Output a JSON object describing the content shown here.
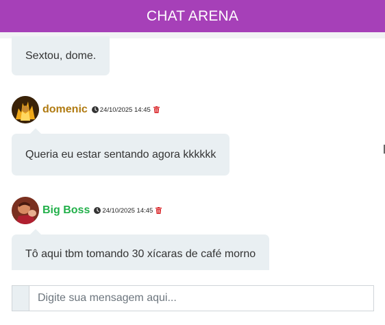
{
  "header": {
    "title": "CHAT ARENA",
    "background": "#a640b8"
  },
  "messages": [
    {
      "text": "Sextou, dome."
    },
    {
      "username": "domenic",
      "username_color": "#b07a10",
      "avatar_icon": "avatar-fire-character",
      "timestamp": "24/10/2025 14:45",
      "text": "Queria eu estar sentando agora kkkkkk"
    },
    {
      "username": "Big Boss",
      "username_color": "#22b04a",
      "avatar_icon": "avatar-cartoon-character",
      "timestamp": "24/10/2025 14:45",
      "text": "Tô aqui tbm tomando 30 xícaras de café morno"
    }
  ],
  "composer": {
    "placeholder": "Digite sua mensagem aqui..."
  },
  "icons": {
    "clock": "clock-icon",
    "trash": "trash-icon",
    "trash_color": "#d9262a"
  }
}
